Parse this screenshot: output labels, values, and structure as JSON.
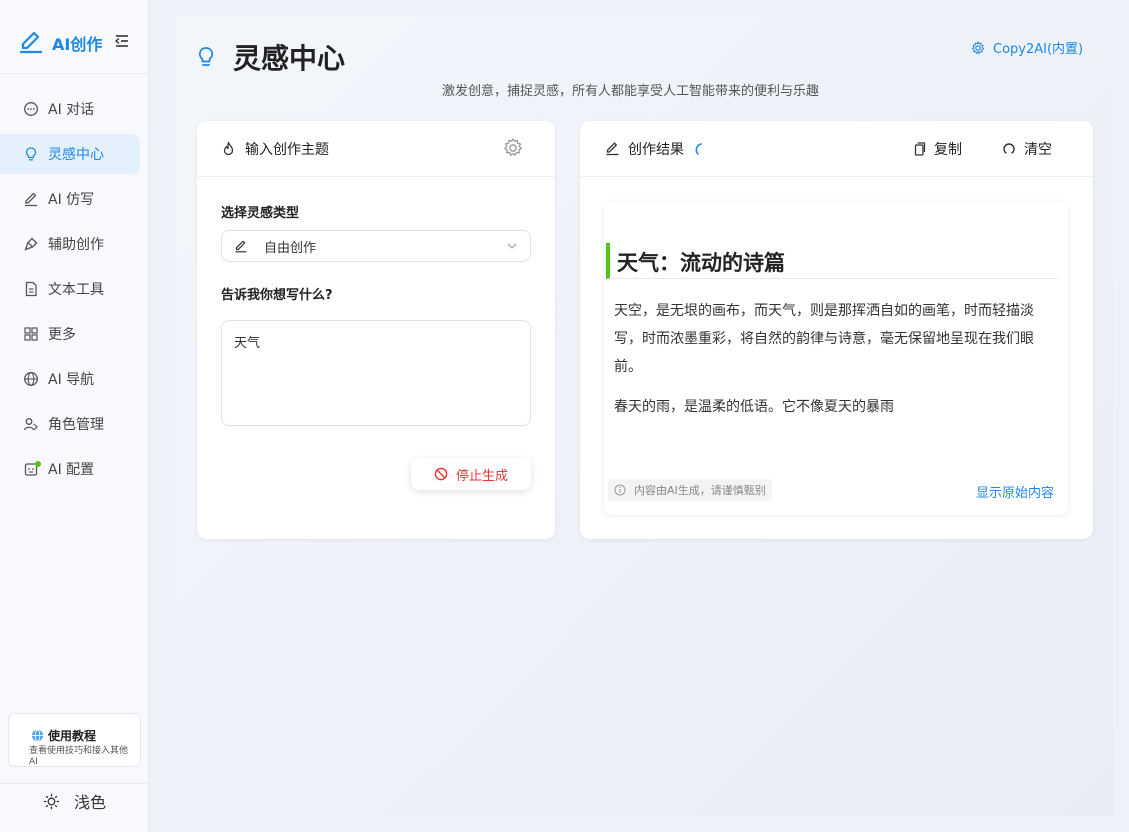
{
  "app": {
    "logo_text": "AI创作"
  },
  "sidebar": {
    "items": [
      {
        "label": "AI 对话",
        "icon": "chat-icon"
      },
      {
        "label": "灵感中心",
        "icon": "bulb-icon",
        "active": true
      },
      {
        "label": "AI 仿写",
        "icon": "pen-icon"
      },
      {
        "label": "辅助创作",
        "icon": "brush-icon"
      },
      {
        "label": "文本工具",
        "icon": "document-icon"
      },
      {
        "label": "更多",
        "icon": "grid-icon"
      },
      {
        "label": "AI 导航",
        "icon": "globe-icon"
      },
      {
        "label": "角色管理",
        "icon": "users-icon"
      },
      {
        "label": "AI 配置",
        "icon": "bot-icon",
        "status_color": "#52c41a"
      }
    ],
    "tutorial": {
      "title": "使用教程",
      "desc": "查看使用技巧和接入其他AI"
    },
    "theme_label": "浅色"
  },
  "header": {
    "title": "灵感中心",
    "subtitle": "激发创意，捕捉灵感，所有人都能享受人工智能带来的便利与乐趣",
    "copy2ai": "Copy2AI(内置)"
  },
  "input_panel": {
    "title": "输入创作主题",
    "type_label": "选择灵感类型",
    "type_value": "自由创作",
    "prompt_label": "告诉我你想写什么?",
    "prompt_value": "天气",
    "stop_label": "停止生成"
  },
  "result_panel": {
    "title": "创作结果",
    "copy_label": "复制",
    "clear_label": "清空",
    "article_title": "天气：流动的诗篇",
    "paragraphs": [
      "天空，是无垠的画布，而天气，则是那挥洒自如的画笔，时而轻描淡写，时而浓墨重彩，将自然的韵律与诗意，毫无保留地呈现在我们眼前。",
      "春天的雨，是温柔的低语。它不像夏天的暴雨"
    ],
    "disclaimer": "内容由AI生成，请谨慎甄别",
    "show_original": "显示原始内容"
  },
  "colors": {
    "accent": "#1e88e5",
    "danger": "#e53935",
    "success": "#52c41a"
  }
}
